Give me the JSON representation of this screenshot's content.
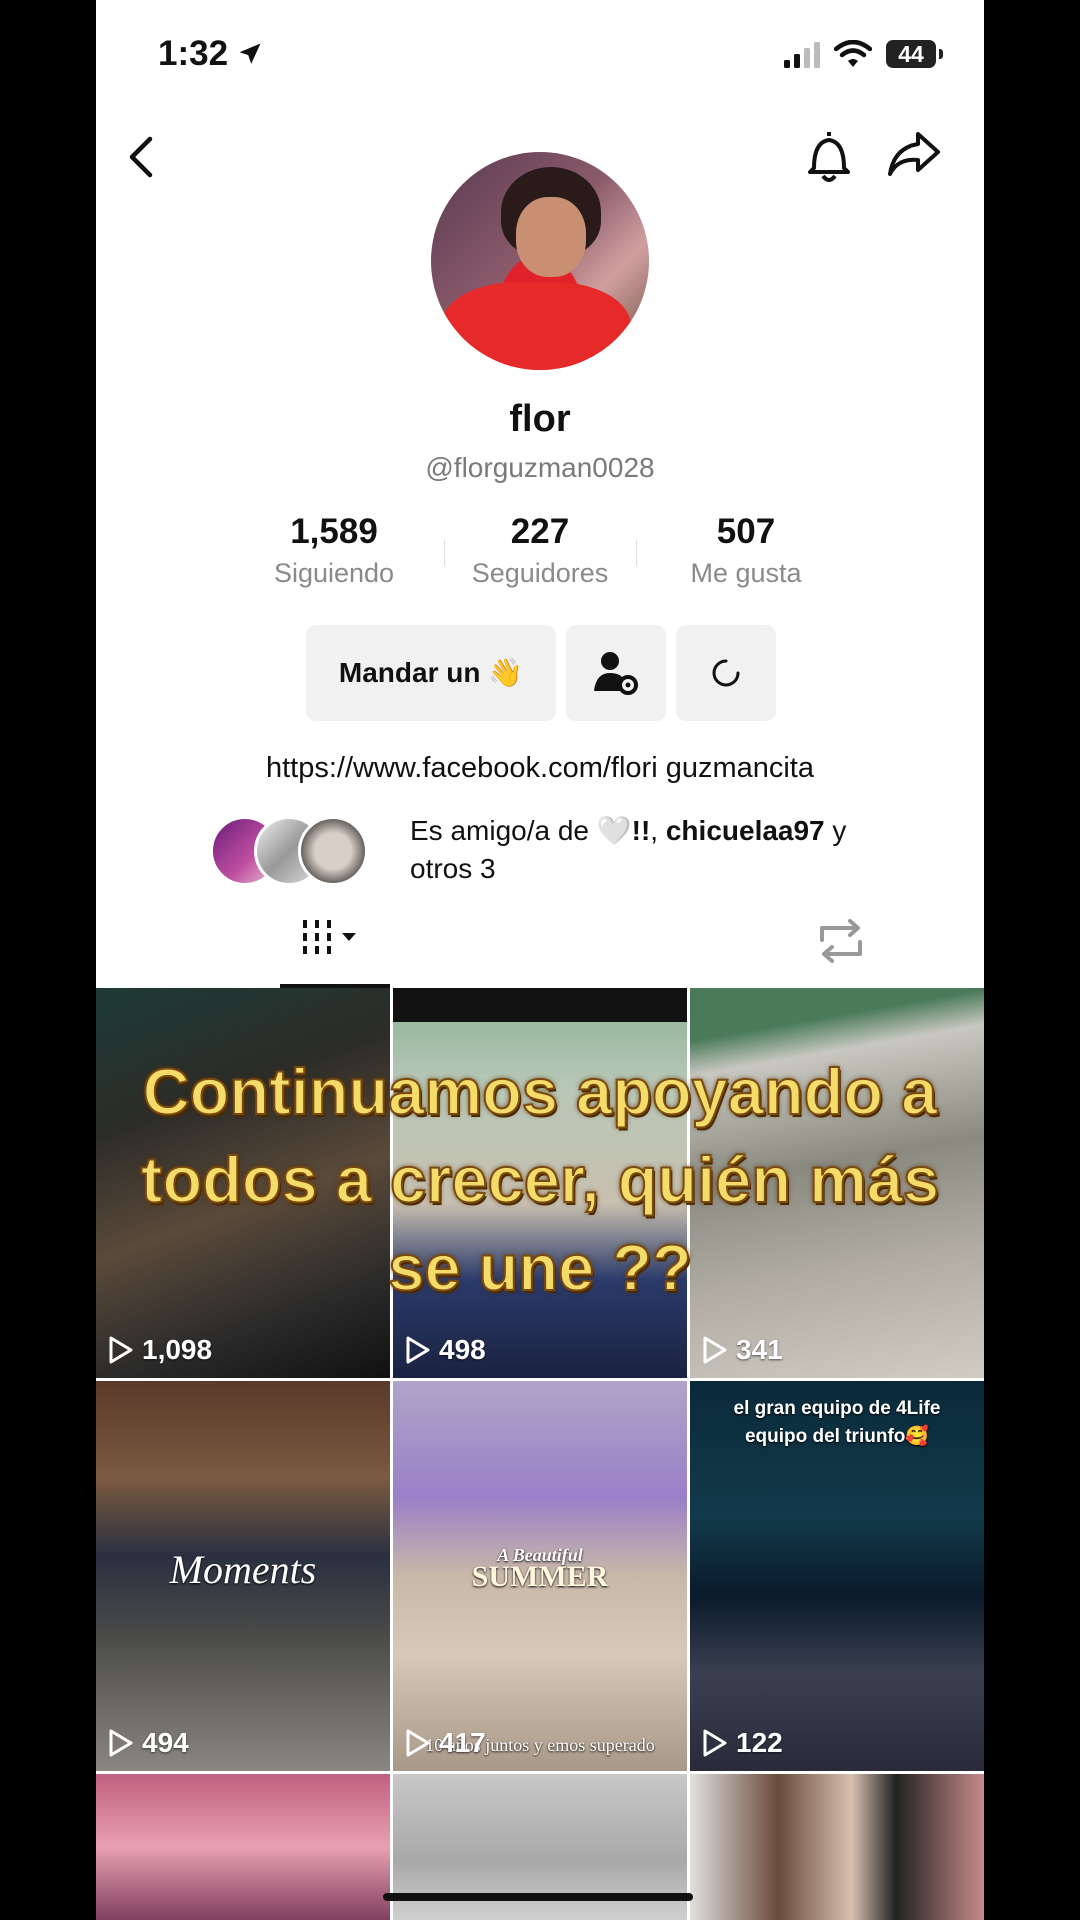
{
  "status_bar": {
    "time": "1:32",
    "battery": "44"
  },
  "profile": {
    "name": "flor",
    "handle": "@florguzman0028",
    "stats": [
      {
        "value": "1,589",
        "label": "Siguiendo"
      },
      {
        "value": "227",
        "label": "Seguidores"
      },
      {
        "value": "507",
        "label": "Me gusta"
      }
    ],
    "wave_button": "Mandar un 👋",
    "bio_link": "https://www.facebook.com/flori guzmancita",
    "friends_prefix": "Es amigo/a de 🤍",
    "friends_name1": "!!",
    "friends_sep": ", ",
    "friends_name2": "chicuelaa97",
    "friends_suffix": " y otros 3"
  },
  "overlay_text": [
    "Continuamos apoyando a",
    "todos a crecer, quién más",
    "se une ??"
  ],
  "videos": [
    {
      "views": "1,098"
    },
    {
      "views": "498"
    },
    {
      "views": "341"
    },
    {
      "views": "494",
      "caption": "Moments"
    },
    {
      "views": "417",
      "caption_top": "A Beautiful",
      "caption": "SUMMER",
      "caption_bottom": "10 años juntos y emos superado"
    },
    {
      "views": "122",
      "caption": "el gran equipo de 4Life equipo del triunfo🥰"
    }
  ],
  "colors": {
    "overlay_text": "#f4dc6a",
    "accent": "#111111"
  }
}
